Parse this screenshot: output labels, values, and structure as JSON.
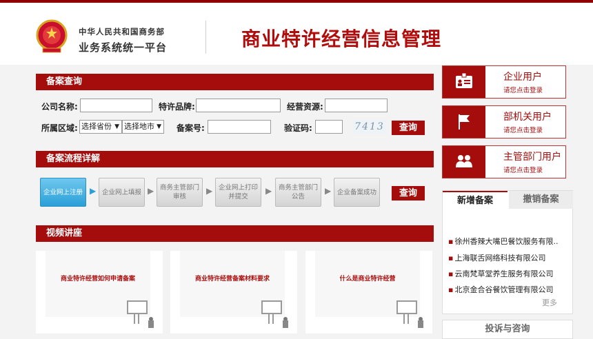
{
  "header": {
    "org_line1": "中华人民共和国商务部",
    "org_line2": "业务系统统一平台",
    "title": "商业特许经营信息管理"
  },
  "query": {
    "section_title": "备案查询",
    "company_label": "公司名称:",
    "brand_label": "特许品牌:",
    "resource_label": "经营资源:",
    "region_label": "所属区域:",
    "province_select": "选择省份",
    "city_select": "选择地市",
    "record_no_label": "备案号:",
    "captcha_label": "验证码:",
    "captcha_image_text": "7413",
    "query_button": "查询"
  },
  "process": {
    "section_title": "备案流程详解",
    "steps": [
      "企业网上注册",
      "企业网上填报",
      "商务主管部门审核",
      "企业网上打印并提交",
      "商务主管部门公告",
      "企业备案成功"
    ],
    "query_button": "查询"
  },
  "video": {
    "section_title": "视频讲座",
    "items": [
      "商业特许经营如何申请备案",
      "商业特许经营备案材料要求",
      "什么是商业特许经营"
    ]
  },
  "users": [
    {
      "title": "企业用户",
      "sub": "请您点击登录",
      "icon": "id-card-icon"
    },
    {
      "title": "部机关用户",
      "sub": "请您点击登录",
      "icon": "flag-icon"
    },
    {
      "title": "主管部门用户",
      "sub": "请您点击登录",
      "icon": "people-icon"
    }
  ],
  "news": {
    "tab_new": "新增备案",
    "tab_cancel": "撤销备案",
    "items": [
      "徐州香辣大嘴巴餐饮服务有限..",
      "上海联舌网络科技有限公司",
      "云南梵草堂养生服务有限公司",
      "北京金合谷餐饮管理有限公司"
    ],
    "more": "更多"
  },
  "consult": {
    "title": "投诉与咨询"
  },
  "colors": {
    "brand_red": "#a50d0d",
    "active_step": "#2a9fd8"
  }
}
